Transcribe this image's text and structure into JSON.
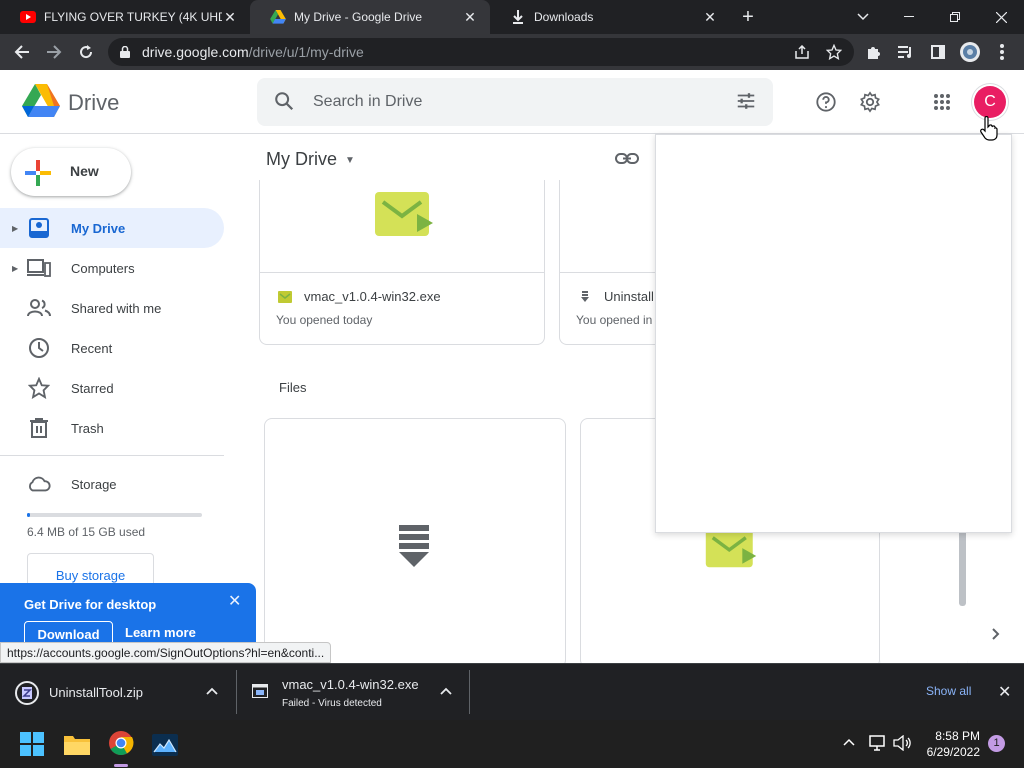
{
  "browser": {
    "tabs": [
      {
        "title": "FLYING OVER TURKEY (4K UHD)",
        "icon": "youtube-icon",
        "active": false
      },
      {
        "title": "My Drive - Google Drive",
        "icon": "drive-icon",
        "active": true
      },
      {
        "title": "Downloads",
        "icon": "download-icon",
        "active": false
      }
    ],
    "url_host": "drive.google.com",
    "url_path": "/drive/u/1/my-drive"
  },
  "drive": {
    "app_name": "Drive",
    "search_placeholder": "Search in Drive",
    "avatar_letter": "C",
    "avatar_color": "#e91e63",
    "new_label": "New",
    "nav": [
      {
        "label": "My Drive",
        "icon": "my-drive-icon",
        "selected": true,
        "expandable": true
      },
      {
        "label": "Computers",
        "icon": "computers-icon",
        "selected": false,
        "expandable": true
      },
      {
        "label": "Shared with me",
        "icon": "shared-icon",
        "selected": false,
        "expandable": false
      },
      {
        "label": "Recent",
        "icon": "clock-icon",
        "selected": false,
        "expandable": false
      },
      {
        "label": "Starred",
        "icon": "star-icon",
        "selected": false,
        "expandable": false
      },
      {
        "label": "Trash",
        "icon": "trash-icon",
        "selected": false,
        "expandable": false
      }
    ],
    "storage_label": "Storage",
    "storage_used": "6.4 MB of 15 GB used",
    "storage_fraction": 0.0004,
    "buy_storage": "Buy storage",
    "promo": {
      "title": "Get Drive for desktop",
      "download": "Download",
      "learn_more": "Learn more"
    },
    "heading": "My Drive",
    "quick_access": [
      {
        "name": "vmac_v1.0.4-win32.exe",
        "sub": "You opened today",
        "type": "exe"
      },
      {
        "name": "Uninstall",
        "sub": "You opened in",
        "type": "zip"
      }
    ],
    "files_label": "Files"
  },
  "status_url": "https://accounts.google.com/SignOutOptions?hl=en&conti...",
  "downloads": {
    "items": [
      {
        "name": "UninstallTool.zip",
        "sub": ""
      },
      {
        "name": "vmac_v1.0.4-win32.exe",
        "sub": "Failed - Virus detected"
      }
    ],
    "show_all": "Show all"
  },
  "taskbar": {
    "time": "8:58 PM",
    "date": "6/29/2022",
    "notifications": "1"
  }
}
